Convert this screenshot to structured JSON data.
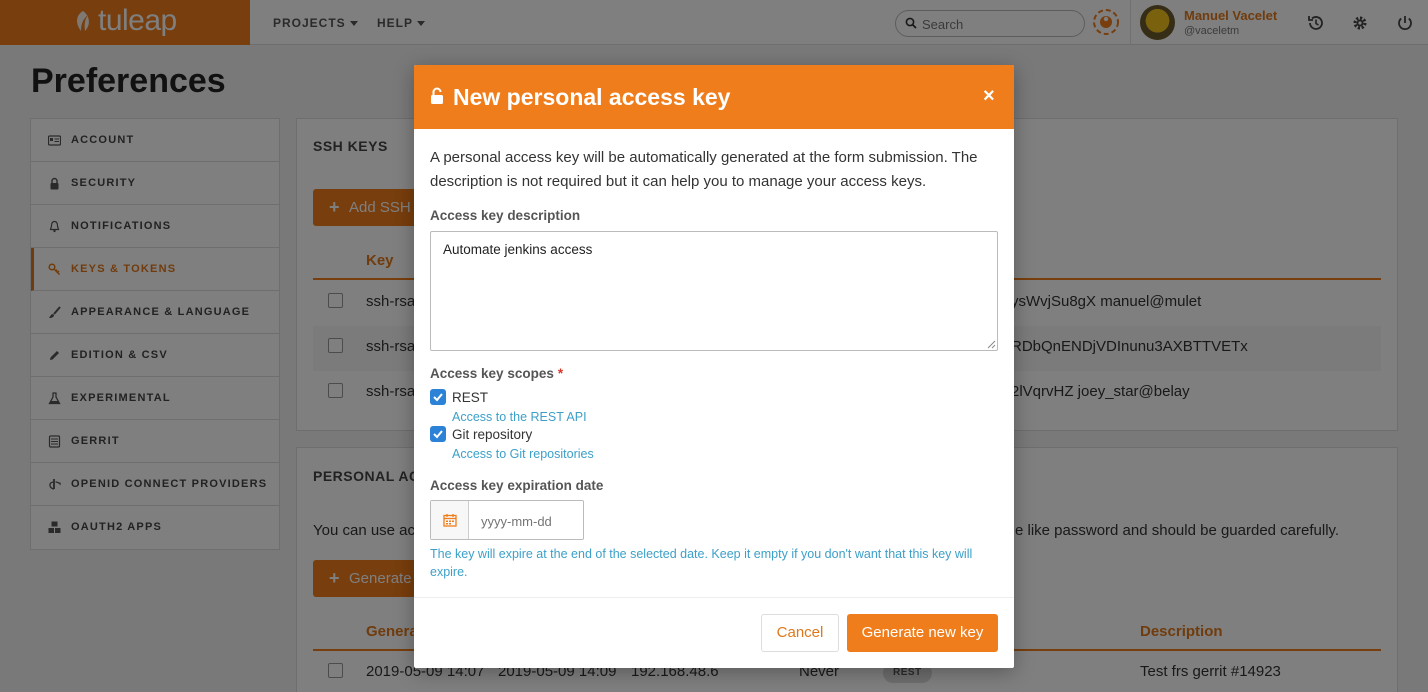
{
  "navbar": {
    "brand": "tuleap",
    "projects_label": "PROJECTS",
    "help_label": "HELP",
    "search_placeholder": "Search",
    "user_name": "Manuel Vacelet",
    "user_login": "@vaceletm"
  },
  "page": {
    "title": "Preferences"
  },
  "sidebar": {
    "items": [
      {
        "label": "ACCOUNT",
        "icon": "id-card-icon"
      },
      {
        "label": "SECURITY",
        "icon": "lock-icon"
      },
      {
        "label": "NOTIFICATIONS",
        "icon": "bell-icon"
      },
      {
        "label": "KEYS & TOKENS",
        "icon": "key-icon",
        "active": true
      },
      {
        "label": "APPEARANCE & LANGUAGE",
        "icon": "brush-icon"
      },
      {
        "label": "EDITION & CSV",
        "icon": "pencil-icon"
      },
      {
        "label": "EXPERIMENTAL",
        "icon": "flask-icon"
      },
      {
        "label": "GERRIT",
        "icon": "server-icon"
      },
      {
        "label": "OPENID CONNECT PROVIDERS",
        "icon": "openid-icon"
      },
      {
        "label": "OAUTH2 APPS",
        "icon": "cubes-icon"
      }
    ]
  },
  "ssh_keys": {
    "title": "SSH KEYS",
    "add_button": "Add SSH k",
    "col_key": "Key",
    "rows": [
      {
        "key_start": "ssh-rsa",
        "key_end": "ysWvjSu8gX manuel@mulet"
      },
      {
        "key_start": "ssh-rsa",
        "key_end": "RDbQnENDjVDInunu3AXBTTVETx"
      },
      {
        "key_start": "ssh-rsa",
        "key_end": "2lVqrvHZ joey_star@belay"
      }
    ]
  },
  "access_keys": {
    "title": "PERSONAL ACC",
    "intro_start": "You can use acc",
    "intro_end": "e like password and should be guarded carefully.",
    "generate_button": "Generate",
    "col_generated": "Genera",
    "col_description": "Description",
    "rows": [
      {
        "created": "2019-05-09 14:07",
        "last_used": "2019-05-09 14:09",
        "ip": "192.168.48.6",
        "expires": "Never",
        "scope": "REST",
        "description": "Test frs gerrit #14923"
      }
    ]
  },
  "modal": {
    "title": "New personal access key",
    "close": "×",
    "intro": "A personal access key will be automatically generated at the form submission. The description is not required but it can help you to manage your access keys.",
    "description_label": "Access key description",
    "description_value": "Automate jenkins access",
    "scopes_label": "Access key scopes",
    "scopes_required": "*",
    "scopes": [
      {
        "label": "REST",
        "help": "Access to the REST API",
        "checked": true
      },
      {
        "label": "Git repository",
        "help": "Access to Git repositories",
        "checked": true
      }
    ],
    "expiration_label": "Access key expiration date",
    "expiration_placeholder": "yyyy-mm-dd",
    "expiration_help": "The key will expire at the end of the selected date. Keep it empty if you don't want that this key will expire.",
    "cancel_label": "Cancel",
    "generate_label": "Generate new key"
  },
  "colors": {
    "brand": "#f07d1b",
    "link": "#3ca0c8",
    "checkbox": "#2c82d6",
    "required": "#d9362b"
  }
}
